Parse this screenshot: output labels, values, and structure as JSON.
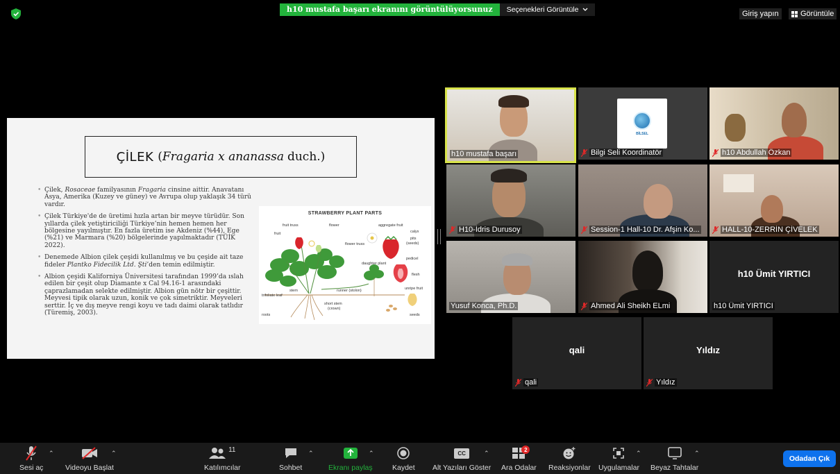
{
  "top": {
    "share_banner": "h10 mustafa başarı ekranını görüntülüyorsunuz",
    "view_options": "Seçenekleri Görüntüle",
    "sign_in": "Giriş yapın",
    "view": "Görüntüle"
  },
  "slide": {
    "title_word": "ÇİLEK",
    "title_species": "Fragaria x ananassa",
    "title_author": "duch.)",
    "bullet1": {
      "a": "Çilek, ",
      "i1": "Rosaceae",
      "b": " familyasının ",
      "i2": "Fragaria",
      "c": " cinsine aittir. Anavatanı Asya, Amerika (Kuzey ve güney) ve Avrupa olup yaklaşık 34 türü vardır."
    },
    "bullet2": "Çilek Türkiye'de de üretimi hızla artan bir meyve türüdür. Son yıllarda çilek yetiştiriciliği Türkiye’nin hemen hemen her bölgesine yayılmıştır. En fazla üretim ise Akdeniz (%44), Ege (%21) ve Marmara (%20) bölgelerinde yapılmaktadır (TÜİK 2022).",
    "bullet3": {
      "a": "Denemede Albion çilek çeşidi kullanılmış ve bu çeşide ait taze fideler ",
      "i": "Plantko Fidecilik Ltd. Şti",
      "b": "’den temin edilmiştir."
    },
    "bullet4": "Albion çeşidi Kaliforniya Üniversitesi tarafından 1999’da ıslah edilen bir çeşit olup Diamante x Cal 94.16-1 arasındaki çaprazlamadan selekte edilmiştir. Albion gün nötr bir çeşittir. Meyvesi tipik olarak uzun, konik ve çok simetriktir. Meyveleri serttir. İç ve dış meyve rengi koyu ve tadı daimi olarak tatlıdır (Türemiş, 2003).",
    "diagram": {
      "title": "STRAWBERRY PLANT PARTS",
      "labels": {
        "fruit_truss": "fruit truss",
        "flower": "flower",
        "aggregate_fruit": "aggregate fruit",
        "calyx": "calyx",
        "fruit": "fruit",
        "pits": "pits",
        "seeds_paren": "(seeds)",
        "flower_truss": "flower truss",
        "daughter_plant": "daughter plant",
        "pedicel": "pedicel",
        "flesh": "flesh",
        "runner": "runner (stolon)",
        "stem": "stem",
        "unripe_fruit": "unripe fruit",
        "trifoliate_leaf": "trifoliate leaf",
        "short_stem": "short stem",
        "crown": "(crown)",
        "roots": "roots",
        "seeds": "seeds"
      }
    }
  },
  "participants": [
    {
      "name": "h10 mustafa başarı",
      "muted": false
    },
    {
      "name": "Bilgi Seli Koordinatör",
      "muted": true,
      "logo_text": "BİLSEL"
    },
    {
      "name": "h10 Abdullah Özkan",
      "muted": true
    },
    {
      "name": "H10-İdris Durusoy",
      "muted": true
    },
    {
      "name": "Session-1 Hall-10 Dr. Afşin Ko...",
      "muted": true
    },
    {
      "name": "HALL-10-ZERRİN ÇİVELEK",
      "muted": true
    },
    {
      "name": "Yusuf Konca, Ph.D.",
      "muted": false
    },
    {
      "name": "Ahmed Ali Sheikh ELmi",
      "muted": true
    },
    {
      "name": "h10 Ümit YIRTICI",
      "muted": false,
      "center": "h10 Ümit YIRTICI"
    },
    {
      "name": "qali",
      "muted": true,
      "center": "qali"
    },
    {
      "name": "Yıldız",
      "muted": true,
      "center": "Yıldız"
    }
  ],
  "toolbar": {
    "unmute": "Sesi aç",
    "start_video": "Videoyu Başlat",
    "participants": "Katılımcılar",
    "participants_count": "11",
    "chat": "Sohbet",
    "share": "Ekranı paylaş",
    "record": "Kaydet",
    "cc_icon": "CC",
    "captions": "Alt Yazıları Göster",
    "breakout": "Ara Odalar",
    "breakout_badge": "2",
    "reactions": "Reaksiyonlar",
    "apps": "Uygulamalar",
    "whiteboards": "Beyaz Tahtalar",
    "leave": "Odadan Çık"
  },
  "colors": {
    "share_green": "#23b33c",
    "active_speaker": "#d8e34a",
    "leave_blue": "#0e72ed",
    "muted_red": "#e02828"
  }
}
